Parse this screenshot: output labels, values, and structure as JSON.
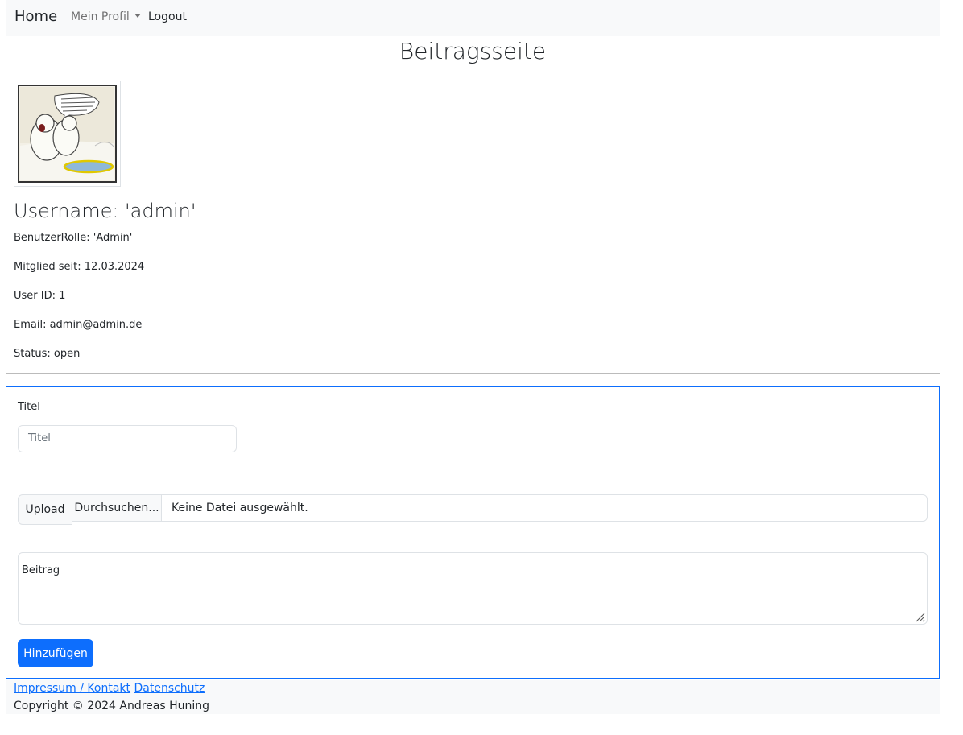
{
  "nav": {
    "brand": "Home",
    "profile": "Mein Profil",
    "logout": "Logout"
  },
  "page_title": "Beitragsseite",
  "profile": {
    "username": "Username: 'admin'",
    "role": "BenutzerRolle: 'Admin'",
    "member_since": "Mitglied seit: 12.03.2024",
    "user_id": "User ID: 1",
    "email": "Email: admin@admin.de",
    "status": "Status: open"
  },
  "form": {
    "title_label": "Titel",
    "title_placeholder": "Titel",
    "upload_label": "Upload",
    "browse_label": "Durchsuchen...",
    "file_status": "Keine Datei ausgewählt.",
    "body_placeholder": "Beitrag",
    "submit_label": "Hinzufügen"
  },
  "footer": {
    "impressum": "Impressum / Kontakt",
    "datenschutz": "Datenschutz",
    "copyright": "Copyright © 2024 Andreas Huning"
  },
  "colors": {
    "primary": "#0d6efd",
    "navbar_bg": "#f8f9fa"
  }
}
